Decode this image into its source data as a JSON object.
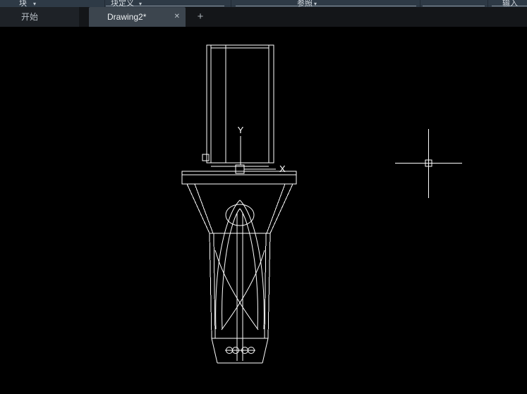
{
  "ribbon": {
    "dropdown_glyph": "▾",
    "groups": [
      {
        "label": "块"
      },
      {
        "label": "块定义"
      },
      {
        "label": "参照"
      },
      {
        "label": "输入"
      }
    ]
  },
  "tabbar": {
    "start_tab": "开始",
    "drawing_tab": "Drawing2*",
    "close_glyph": "✕",
    "new_tab_glyph": "+"
  },
  "canvas": {
    "ucs_y": "Y",
    "ucs_x": "X"
  },
  "colors": {
    "ribbon_bg": "#2e3a46",
    "tabbar_bg": "#141619",
    "active_tab_bg": "#3c454e",
    "canvas_bg": "#000000",
    "line_color": "#ffffff"
  }
}
